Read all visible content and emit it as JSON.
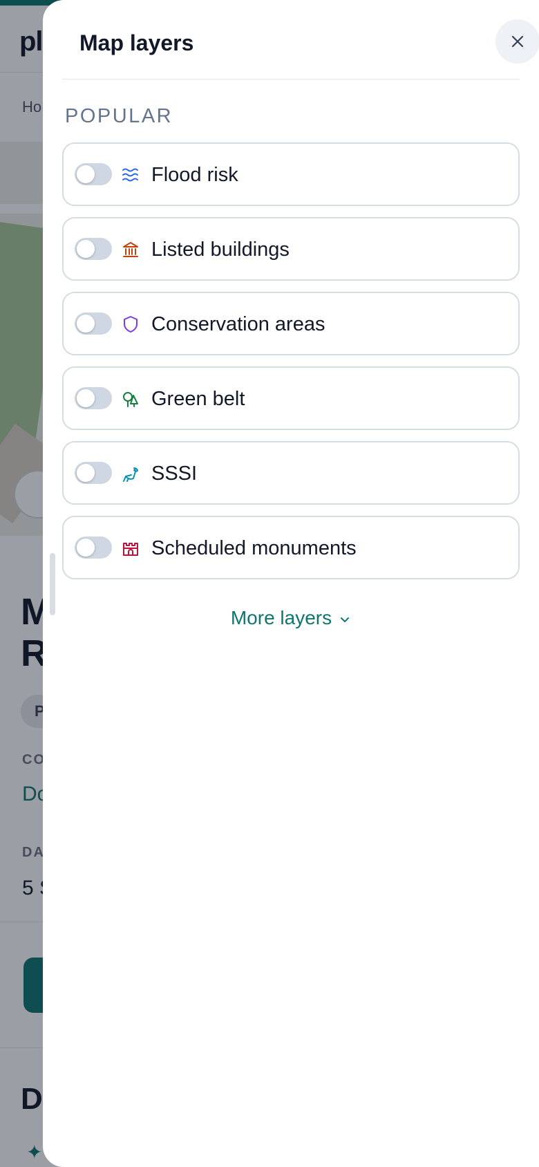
{
  "background": {
    "logo_partial": "pl",
    "breadcrumb_partial": "Ho",
    "title_partial": "M\nR",
    "chip_partial": "P",
    "label1_partial": "CO",
    "link_partial": "Do",
    "label2_partial": "DA",
    "date_partial": "5 S",
    "heading_partial": "D",
    "sparkle": "✦"
  },
  "drawer": {
    "title": "Map layers",
    "close_icon": "close-icon",
    "section_label": "POPULAR",
    "layers": [
      {
        "label": "Flood risk",
        "icon": "waves-icon",
        "color": "#2563eb",
        "enabled": false
      },
      {
        "label": "Listed buildings",
        "icon": "landmark-icon",
        "color": "#c2410c",
        "enabled": false
      },
      {
        "label": "Conservation areas",
        "icon": "shield-icon",
        "color": "#7c3aed",
        "enabled": false
      },
      {
        "label": "Green belt",
        "icon": "trees-icon",
        "color": "#15803d",
        "enabled": false
      },
      {
        "label": "SSSI",
        "icon": "bird-icon",
        "color": "#0891b2",
        "enabled": false
      },
      {
        "label": "Scheduled monuments",
        "icon": "castle-icon",
        "color": "#be123c",
        "enabled": false
      }
    ],
    "more_layers_label": "More layers",
    "more_layers_icon": "chevron-down-icon",
    "accent_color": "#0f766e"
  }
}
